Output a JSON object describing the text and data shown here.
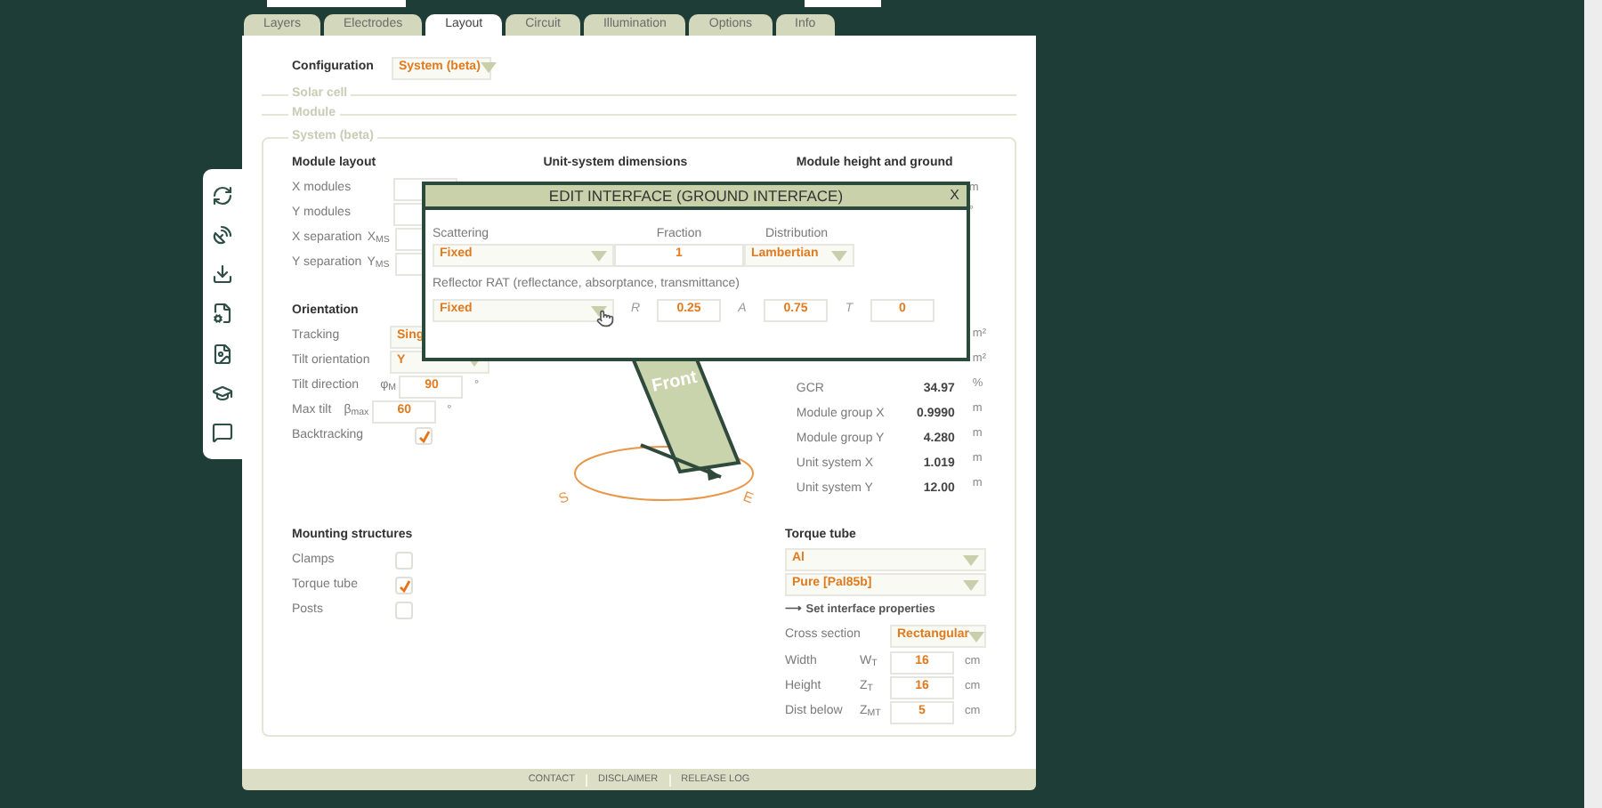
{
  "tabs": [
    {
      "label": "Layers",
      "selected": false
    },
    {
      "label": "Electrodes",
      "selected": false
    },
    {
      "label": "Layout",
      "selected": true
    },
    {
      "label": "Circuit",
      "selected": false
    },
    {
      "label": "Illumination",
      "selected": false
    },
    {
      "label": "Options",
      "selected": false
    },
    {
      "label": "Info",
      "selected": false
    }
  ],
  "configuration": {
    "label": "Configuration",
    "value": "System (beta)"
  },
  "collapsed_sections": [
    "Solar cell",
    "Module"
  ],
  "system": {
    "title": "System (beta)"
  },
  "module_layout": {
    "title": "Module layout",
    "rows": [
      {
        "label": "X modules"
      },
      {
        "label": "Y modules"
      },
      {
        "label": "X separation",
        "symbol": "X$_{MS}$"
      },
      {
        "label": "Y separation",
        "symbol": "Y$_{MS}$"
      }
    ]
  },
  "orientation": {
    "title": "Orientation",
    "rows": [
      {
        "kind": "select",
        "label": "Tracking",
        "value": "Sing"
      },
      {
        "kind": "select",
        "label": "Tilt orientation",
        "value": "Y"
      },
      {
        "kind": "number",
        "label": "Tilt direction",
        "symbol": "φ$_{M}$",
        "value": "90",
        "unit": "°"
      },
      {
        "kind": "number",
        "label": "Max tilt",
        "symbol": "β$_{max}$",
        "value": "60",
        "unit": "°"
      },
      {
        "kind": "checkbox",
        "label": "Backtracking",
        "checked": true
      }
    ]
  },
  "unit_system": {
    "title": "Unit-system dimensions"
  },
  "diagram": {
    "label": "Front",
    "compass": [
      "S",
      "E"
    ]
  },
  "module_height": {
    "title": "Module height and ground",
    "units": [
      "m",
      "°"
    ]
  },
  "results": [
    {
      "unit": "m²"
    },
    {
      "unit": "m²"
    },
    {
      "label": "GCR",
      "value": "34.97",
      "unit": "%"
    },
    {
      "label": "Module group X",
      "value": "0.9990",
      "unit": "m"
    },
    {
      "label": "Module group Y",
      "value": "4.280",
      "unit": "m"
    },
    {
      "label": "Unit system X",
      "value": "1.019",
      "unit": "m"
    },
    {
      "label": "Unit system Y",
      "value": "12.00",
      "unit": "m"
    }
  ],
  "mounting": {
    "title": "Mounting structures",
    "items": [
      {
        "label": "Clamps",
        "checked": false
      },
      {
        "label": "Torque tube",
        "checked": true
      },
      {
        "label": "Posts",
        "checked": false
      }
    ]
  },
  "torque_tube": {
    "title": "Torque tube",
    "material": "Al",
    "grade": "Pure [Pal85b]",
    "link": "⟶ Set interface properties",
    "cross_section": {
      "label": "Cross section",
      "value": "Rectangular"
    },
    "rows": [
      {
        "label": "Width",
        "symbol": "W$_{T}$",
        "value": "16",
        "unit": "cm"
      },
      {
        "label": "Height",
        "symbol": "Z$_{T}$",
        "value": "16",
        "unit": "cm"
      },
      {
        "label": "Dist below",
        "symbol": "Z$_{MT}$",
        "value": "5",
        "unit": "cm"
      }
    ]
  },
  "footer": [
    "CONTACT",
    "DISCLAIMER",
    "RELEASE LOG"
  ],
  "modal": {
    "title": "EDIT INTERFACE (GROUND INTERFACE)",
    "close": "X",
    "scattering": {
      "label": "Scattering",
      "value": "Fixed"
    },
    "fraction": {
      "label": "Fraction",
      "value": "1"
    },
    "distribution": {
      "label": "Distribution",
      "value": "Lambertian"
    },
    "reflector": {
      "label": "Reflector RAT (reflectance, absorptance, transmittance)",
      "value": "Fixed",
      "fields": [
        {
          "symbol": "R",
          "value": "0.25"
        },
        {
          "symbol": "A",
          "value": "0.75"
        },
        {
          "symbol": "T",
          "value": "0"
        }
      ]
    }
  }
}
